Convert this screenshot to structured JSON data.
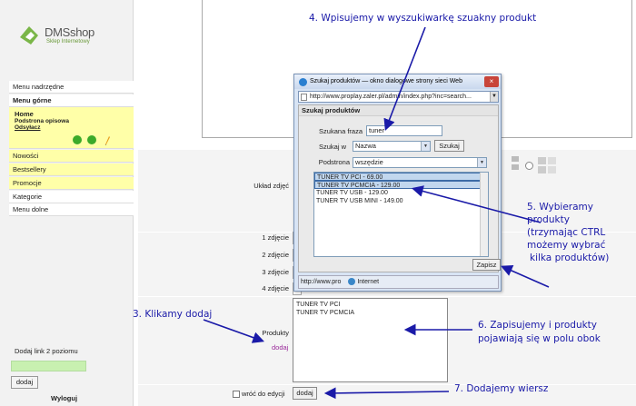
{
  "logo": {
    "name": "DMSshop",
    "tagline": "Sklep Internetowy"
  },
  "sidebar": {
    "items": [
      {
        "label": "Menu nadrzędne"
      },
      {
        "label": "Menu górne"
      },
      {
        "label": "Nowości"
      },
      {
        "label": "Bestsellery"
      },
      {
        "label": "Promocje"
      },
      {
        "label": "Kategorie"
      },
      {
        "label": "Menu dolne"
      }
    ],
    "home": {
      "title": "Home",
      "subtitle": "Podstrona opisowa",
      "link": "Odsyłacz"
    },
    "add_label": "Dodaj link 2 poziomu",
    "add_button": "dodaj",
    "logout": "Wyloguj"
  },
  "form": {
    "layout_label": "Układ zdjęć",
    "photo_labels": [
      "1 zdjęcie",
      "2 zdjęcie",
      "3 zdjęcie",
      "4 zdjęcie"
    ],
    "products_label": "Produkty",
    "products_link": "dodaj",
    "products_value": [
      "TUNER TV PCI",
      "TUNER TV PCMCIA"
    ],
    "back_label": "wróć do edycji",
    "add_row_button": "dodaj"
  },
  "dialog": {
    "title": "Szukaj produktów — okno dialogowe strony sieci Web",
    "close": "×",
    "url": "http://www.proplay.zaler.pl/admin/index.php?inc=search...",
    "heading": "Szukaj produktów",
    "phrase_label": "Szukana fraza",
    "phrase_value": "tuner",
    "search_in_label": "Szukaj w",
    "search_in_value": "Nazwa",
    "search_button": "Szukaj",
    "subpage_label": "Podstrona",
    "subpage_value": "wszędzie",
    "results": [
      {
        "label": "TUNER TV PCI - 69.00",
        "selected": true
      },
      {
        "label": "TUNER TV PCMCIA - 129.00",
        "selected": true
      },
      {
        "label": "TUNER TV USB - 129.00",
        "selected": false
      },
      {
        "label": "TUNER TV USB MINI - 149.00",
        "selected": false
      }
    ],
    "save_button": "Zapisz",
    "status_url": "http://www.pro",
    "status_zone": "Internet"
  },
  "annotations": {
    "step3": "3. Klikamy dodaj",
    "step4": "4. Wpisujemy w wyszukiwarkę szuakny produkt",
    "step5": [
      "5. Wybieramy",
      "produkty",
      "(trzymając CTRL",
      "możemy wybrać",
      "kilka produktów)"
    ],
    "step6": [
      "6. Zapisujemy i produkty",
      "pojawiają się w polu obok"
    ],
    "step7": "7. Dodajemy wiersz"
  },
  "colors": {
    "highlight": "#ffffa8",
    "annotation": "#1a1aa8",
    "accent_green": "#6a9a3a"
  }
}
